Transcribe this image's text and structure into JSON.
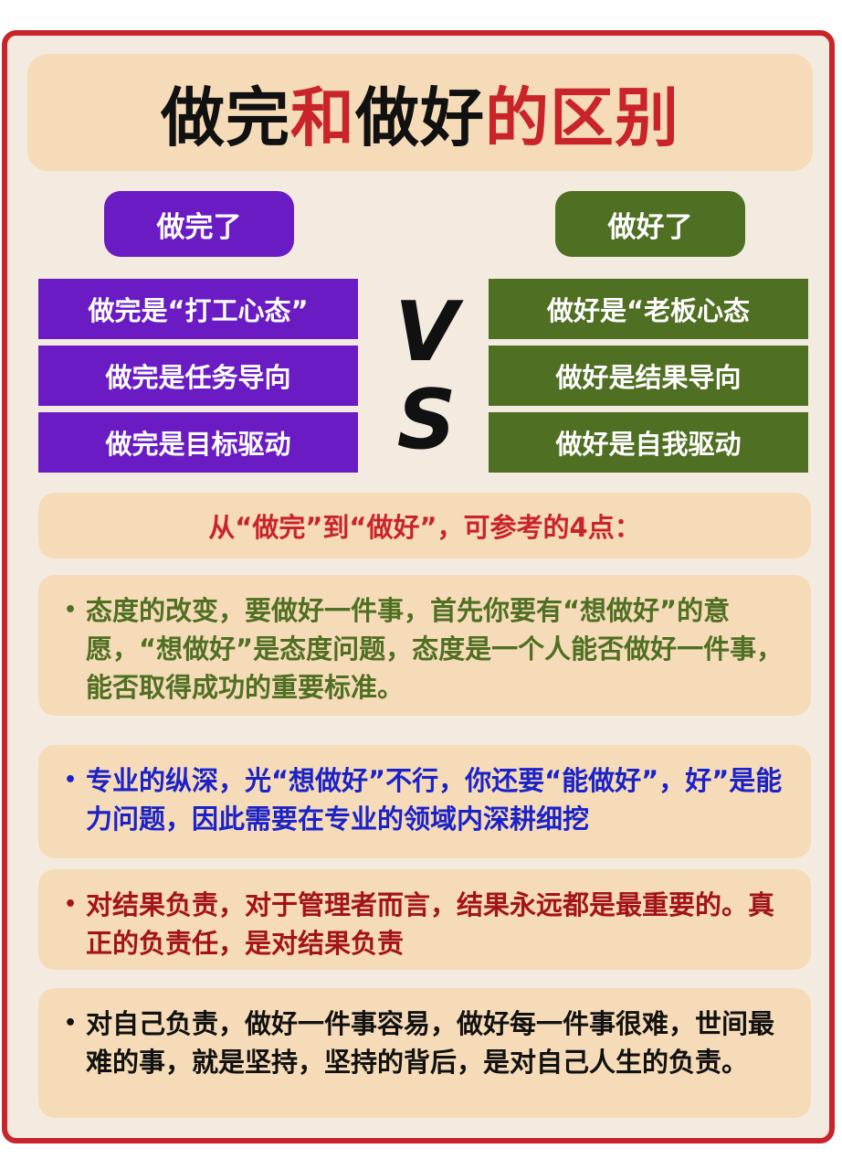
{
  "title": {
    "part1": "做完",
    "part2": "和",
    "part3": "做好",
    "part4": "的区别"
  },
  "left": {
    "header": "做完了",
    "items": [
      "做完是“打工心态”",
      "做完是任务导向",
      "做完是目标驱动"
    ]
  },
  "right": {
    "header": "做好了",
    "items": [
      "做好是“老板心态",
      "做好是结果导向",
      "做好是自我驱动"
    ]
  },
  "vs": {
    "v": "V",
    "s": "S"
  },
  "subtitle": "从“做完”到“做好”，可参考的4点：",
  "points": [
    {
      "bullet": "•",
      "text": "态度的改变，要做好一件事，首先你要有“想做好”的意愿，“想做好”是态度问题，态度是一个人能否做好一件事，能否取得成功的重要标准。",
      "color": "#4f6f22"
    },
    {
      "bullet": "•",
      "text": "专业的纵深，光“想做好”不行，你还要“能做好”，好”是能力问题，因此需要在专业的领域内深耕细挖",
      "color": "#1b22c8"
    },
    {
      "bullet": "•",
      "text": "对结果负责，对于管理者而言，结果永远都是最重要的。真正的负责任，是对结果负责",
      "color": "#a3141a"
    },
    {
      "bullet": "•",
      "text": "对自己负责，做好一件事容易，做好每一件事很难，世间最难的事，就是坚持，坚持的背后，是对自己人生的负责。",
      "color": "#111111"
    }
  ],
  "colors": {
    "frame": "#c8242a",
    "purple": "#6a1bc4",
    "green": "#4f6f22",
    "panel": "#f6dbb8"
  }
}
